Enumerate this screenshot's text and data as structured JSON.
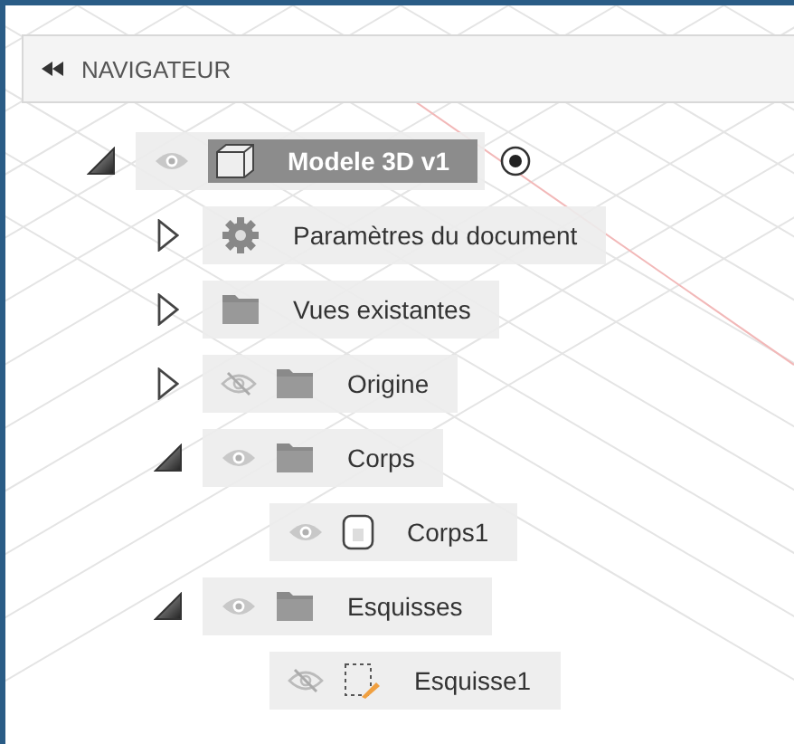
{
  "panel": {
    "title": "NAVIGATEUR"
  },
  "tree": [
    {
      "label": "Modele 3D v1",
      "kind": "component",
      "expanded": true,
      "visible": true,
      "active": true,
      "children": [
        {
          "label": "Paramètres du document",
          "kind": "settings",
          "expanded": false
        },
        {
          "label": "Vues existantes",
          "kind": "folder",
          "expanded": false
        },
        {
          "label": "Origine",
          "kind": "folder",
          "expanded": false,
          "visible": false
        },
        {
          "label": "Corps",
          "kind": "folder",
          "expanded": true,
          "visible": true,
          "children": [
            {
              "label": "Corps1",
              "kind": "body",
              "visible": true
            }
          ]
        },
        {
          "label": "Esquisses",
          "kind": "folder",
          "expanded": true,
          "visible": true,
          "children": [
            {
              "label": "Esquisse1",
              "kind": "sketch",
              "visible": false
            }
          ]
        }
      ]
    }
  ]
}
